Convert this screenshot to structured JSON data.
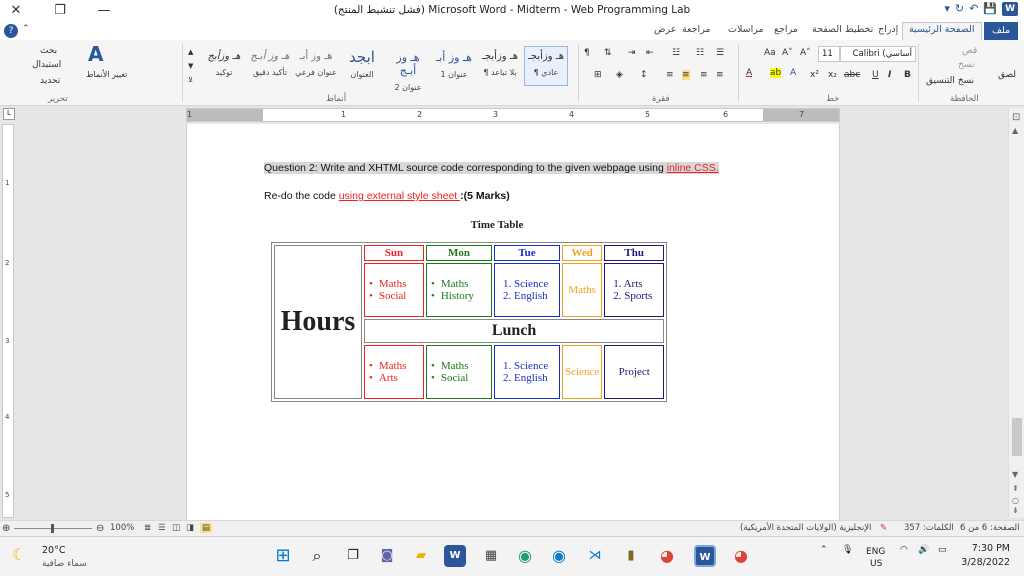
{
  "window": {
    "title": "(فشل تنشيط المنتج) Microsoft Word - Midterm - Web Programming Lab",
    "close": "✕",
    "restore": "❐",
    "minimize": "—"
  },
  "quick_access": [
    "▾",
    "↻",
    "↶",
    "💾",
    "W"
  ],
  "tabs": {
    "file": "ملف",
    "home": "الصفحة الرئيسية",
    "insert": "إدراج",
    "layout": "تخطيط الصفحة",
    "references": "مراجع",
    "mailings": "مراسلات",
    "review": "مراجعة",
    "view": "عرض"
  },
  "ribbon": {
    "clipboard": {
      "paste": "لصق",
      "cut": "قص",
      "copy": "نسخ",
      "format_painter": "نسخ التنسيق",
      "label": "الحافظة"
    },
    "font": {
      "name": "Calibri (أساسي",
      "size": "11",
      "grow": "A˄",
      "shrink": "A˅",
      "case": "Aa",
      "bold": "B",
      "italic": "I",
      "underline": "U",
      "strike": "abc",
      "sub": "x₂",
      "sup": "x²",
      "label": "خط"
    },
    "paragraph": {
      "label": "فقرة"
    },
    "styles": {
      "label": "أنماط",
      "items": [
        {
          "sample": "هـ وزأبجـ",
          "name": "¶ عادي",
          "selected": true
        },
        {
          "sample": "هـ وزأبجـ",
          "name": "¶ بلا تباعد"
        },
        {
          "sample": "هـ وز أبـ",
          "name": "عنوان 1"
        },
        {
          "sample": "هـ وز أبـج",
          "name": "عنوان 2"
        },
        {
          "sample": "ابجد",
          "name": "العنوان"
        },
        {
          "sample": "هـ وز أبـ",
          "name": "عنوان فرعي"
        },
        {
          "sample": "هـ وز أبـج",
          "name": "تأكيد دقيق"
        },
        {
          "sample": "هـ وزأبج",
          "name": "توكيد"
        }
      ]
    },
    "editing": {
      "find": "بحث",
      "replace": "استبدال",
      "select": "تحديد",
      "change_styles": "تغيير الأنماط",
      "label": "تحرير"
    }
  },
  "ruler": {
    "h": [
      "1",
      "1",
      "2",
      "3",
      "4",
      "5",
      "6",
      "7"
    ],
    "v": [
      "1",
      "2",
      "3",
      "4",
      "5"
    ]
  },
  "document": {
    "q2_prefix": "Question 2: Write and XHTML source code corresponding to the given webpage using ",
    "q2_link": "inline CSS.",
    "redo_prefix": "Re-do the code ",
    "redo_link": "using external style sheet ",
    "redo_suffix": ":(5 Marks)",
    "table_title": "Time Table",
    "table": {
      "hours": "Hours",
      "days": [
        "Sun",
        "Mon",
        "Tue",
        "Wed",
        "Thu"
      ],
      "row1": {
        "sun": [
          "Maths",
          "Social"
        ],
        "mon": [
          "Maths",
          "History"
        ],
        "tue": [
          "1. Science",
          "2. English"
        ],
        "wed": "Maths",
        "thu": [
          "1. Arts",
          "2. Sports"
        ]
      },
      "lunch": "Lunch",
      "row2": {
        "sun": [
          "Maths",
          "Arts"
        ],
        "mon": [
          "Maths",
          "Social"
        ],
        "tue": [
          "1. Science",
          "2. English"
        ],
        "wed": "Science",
        "thu": "Project"
      }
    }
  },
  "status": {
    "page": "الصفحة: 6 من 6",
    "words": "الكلمات: 357",
    "language": "الإنجليزية (الولايات المتحدة الأمريكية)",
    "zoom": "100%"
  },
  "taskbar": {
    "temperature": "20°C",
    "weather": "سماء صافية",
    "lang": "ENG",
    "region": "US",
    "time": "7:30 PM",
    "date": "3/28/2022"
  }
}
